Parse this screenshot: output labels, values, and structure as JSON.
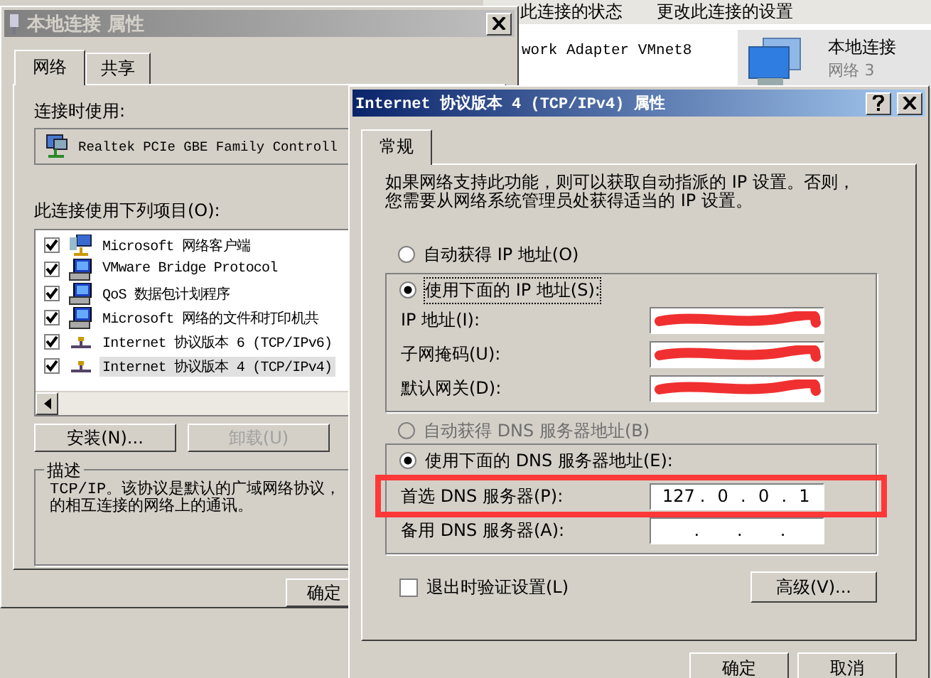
{
  "background_window": {
    "links": [
      "此连接的状态",
      "更改此连接的设置"
    ],
    "connections": [
      {
        "name": "work Adapter VMnet8",
        "selected": false
      },
      {
        "name": "本地连接",
        "subtitle": "网络 3",
        "selected": true
      }
    ]
  },
  "local_dialog": {
    "title": "本地连接 属性",
    "active": false,
    "tabs": [
      {
        "label": "网络",
        "selected": true
      },
      {
        "label": "共享",
        "selected": false
      }
    ],
    "connect_using_label": "连接时使用:",
    "adapter": "Realtek PCIe GBE Family Controll",
    "items_label": "此连接使用下列项目(O):",
    "components": [
      {
        "kind": "client",
        "name": "Microsoft 网络客户端",
        "checked": true,
        "selected": false
      },
      {
        "kind": "service",
        "name": "VMware Bridge Protocol",
        "checked": true,
        "selected": false
      },
      {
        "kind": "service",
        "name": "QoS 数据包计划程序",
        "checked": true,
        "selected": false
      },
      {
        "kind": "service",
        "name": "Microsoft 网络的文件和打印机共",
        "checked": true,
        "selected": false
      },
      {
        "kind": "protocol",
        "name": "Internet 协议版本 6 (TCP/IPv6)",
        "checked": true,
        "selected": false
      },
      {
        "kind": "protocol",
        "name": "Internet 协议版本 4 (TCP/IPv4)",
        "checked": true,
        "selected": true
      }
    ],
    "buttons": [
      {
        "label": "安装(N)...",
        "disabled": false
      },
      {
        "label": "卸载(U)",
        "disabled": true
      }
    ],
    "description_title": "描述",
    "description_lines": [
      "TCP/IP。该协议是默认的广域网络协议，",
      "的相互连接的网络上的通讯。"
    ],
    "ok_button": "确定"
  },
  "ipv4_dialog": {
    "title": "Internet 协议版本 4 (TCP/IPv4) 属性",
    "active": true,
    "tabs": [
      {
        "label": "常规",
        "selected": true
      }
    ],
    "intro_lines": [
      "如果网络支持此功能，则可以获取自动指派的 IP 设置。否则，",
      "您需要从网络系统管理员处获得适当的 IP 设置。"
    ],
    "ip_options": [
      {
        "label": "自动获得 IP 地址(O)",
        "selected": false,
        "disabled": false
      },
      {
        "label": "使用下面的 IP 地址(S):",
        "selected": true,
        "disabled": false
      }
    ],
    "ip_fields": [
      {
        "label": "IP 地址(I):",
        "redacted": true
      },
      {
        "label": "子网掩码(U):",
        "redacted": true
      },
      {
        "label": "默认网关(D):",
        "redacted": true
      }
    ],
    "dns_options": [
      {
        "label": "自动获得 DNS 服务器地址(B)",
        "selected": false,
        "disabled": true
      },
      {
        "label": "使用下面的 DNS 服务器地址(E):",
        "selected": true,
        "disabled": false
      }
    ],
    "dns_fields": [
      {
        "label": "首选 DNS 服务器(P):",
        "octets": [
          "127",
          "0",
          "0",
          "1"
        ],
        "dots": [
          ".",
          ".",
          "."
        ],
        "highlighted": true
      },
      {
        "label": "备用 DNS 服务器(A):",
        "dots": [
          ".",
          ".",
          "."
        ],
        "highlighted": false
      }
    ],
    "validate_checkbox": {
      "label": "退出时验证设置(L)",
      "checked": false
    },
    "advanced_button": "高级(V)...",
    "buttons": [
      "确定",
      "取消"
    ]
  }
}
